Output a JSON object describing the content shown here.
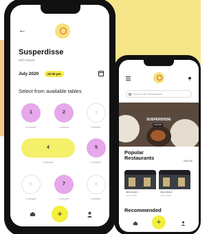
{
  "booking_screen": {
    "title": "Susperdisse",
    "subtitle": "With friends",
    "date": "July 2020",
    "time": "02:00 pm",
    "section_label": "Select from available tables",
    "tables": [
      {
        "number": "1",
        "people": "4 people"
      },
      {
        "number": "2",
        "people": "4 people"
      },
      {
        "number": "3",
        "people": "4 people"
      },
      {
        "number": "4",
        "people": "8 people"
      },
      {
        "number": "5",
        "people": "4 people"
      },
      {
        "number": "6",
        "people": "4 people"
      },
      {
        "number": "7",
        "people": "4 people"
      },
      {
        "number": "8",
        "people": "4 people"
      }
    ],
    "add_label": "+"
  },
  "restaurants_screen": {
    "search_placeholder": "Search the Restaurants",
    "hero_title": "SUSPERDISSE",
    "hero_sub": "ITALIAN",
    "popular_title_line1": "Popular",
    "popular_title_line2": "Restaurants",
    "see_all": "See All",
    "cards": [
      {
        "name": "Alpine Eatery",
        "address": "Louis Street"
      },
      {
        "name": "Alpine Eatery",
        "address": "Louis Street"
      }
    ],
    "recommended_title": "Recommended",
    "add_label": "+"
  },
  "colors": {
    "accent_yellow": "#f4ee3c",
    "pink": "#e6a8ea",
    "background_yellow": "#f7e58a",
    "background_orange": "#f7c98a"
  },
  "icons": [
    "back-arrow-icon",
    "logo-icon",
    "calendar-icon",
    "home-icon",
    "user-icon",
    "menu-icon",
    "bell-icon",
    "search-icon"
  ]
}
